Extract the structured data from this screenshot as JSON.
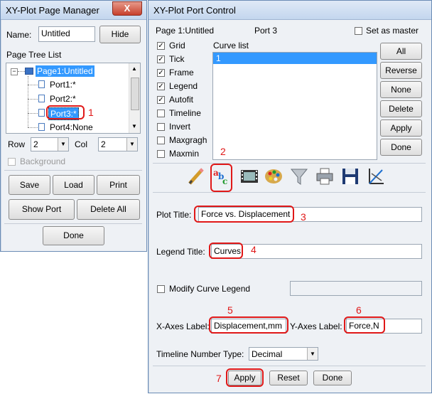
{
  "page_manager": {
    "title": "XY-Plot Page Manager",
    "close_label": "X",
    "name_label": "Name:",
    "name_value": "Untitled",
    "hide_label": "Hide",
    "tree_label": "Page Tree List",
    "tree": {
      "root": "Page1:Untitled",
      "ports": [
        "Port1:*",
        "Port2:*",
        "Port3:*",
        "Port4:None"
      ]
    },
    "row_label": "Row",
    "row_value": "2",
    "col_label": "Col",
    "col_value": "2",
    "background_label": "Background",
    "save_label": "Save",
    "load_label": "Load",
    "print_label": "Print",
    "show_port_label": "Show Port",
    "delete_all_label": "Delete All",
    "done_label": "Done"
  },
  "port_control": {
    "title": "XY-Plot Port Control",
    "page_label": "Page 1:Untitled",
    "port_label": "Port 3",
    "set_master_label": "Set as master",
    "options": [
      {
        "label": "Grid",
        "checked": true
      },
      {
        "label": "Tick",
        "checked": true
      },
      {
        "label": "Frame",
        "checked": true
      },
      {
        "label": "Legend",
        "checked": true
      },
      {
        "label": "Autofit",
        "checked": true
      },
      {
        "label": "Timeline",
        "checked": false
      },
      {
        "label": "Invert",
        "checked": false
      },
      {
        "label": "Maxgragh",
        "checked": false
      },
      {
        "label": "Maxmin",
        "checked": false
      }
    ],
    "curve_list_label": "Curve list",
    "curves": [
      "1"
    ],
    "side_buttons": [
      "All",
      "Reverse",
      "None",
      "Delete",
      "Apply",
      "Done"
    ],
    "toolbar_icons": [
      "pencil-icon",
      "text-abc-icon",
      "film-icon",
      "palette-icon",
      "funnel-icon",
      "printer-icon",
      "floppy-disk-icon",
      "axes-icon"
    ],
    "plot_title_label": "Plot Title:",
    "plot_title_value": "Force vs. Displacement",
    "legend_title_label": "Legend Title:",
    "legend_title_value": "Curves",
    "modify_legend_label": "Modify Curve Legend",
    "x_axes_label": "X-Axes Label:",
    "x_axes_value": "Displacement,mm",
    "y_axes_label": "Y-Axes Label:",
    "y_axes_value": "Force,N",
    "timeline_type_label": "Timeline Number Type:",
    "timeline_type_value": "Decimal",
    "apply_label": "Apply",
    "reset_label": "Reset",
    "done_label": "Done"
  },
  "annotations": [
    "1",
    "2",
    "3",
    "4",
    "5",
    "6",
    "7"
  ],
  "colors": {
    "annotation": "#e01818",
    "selection": "#3399ff"
  }
}
